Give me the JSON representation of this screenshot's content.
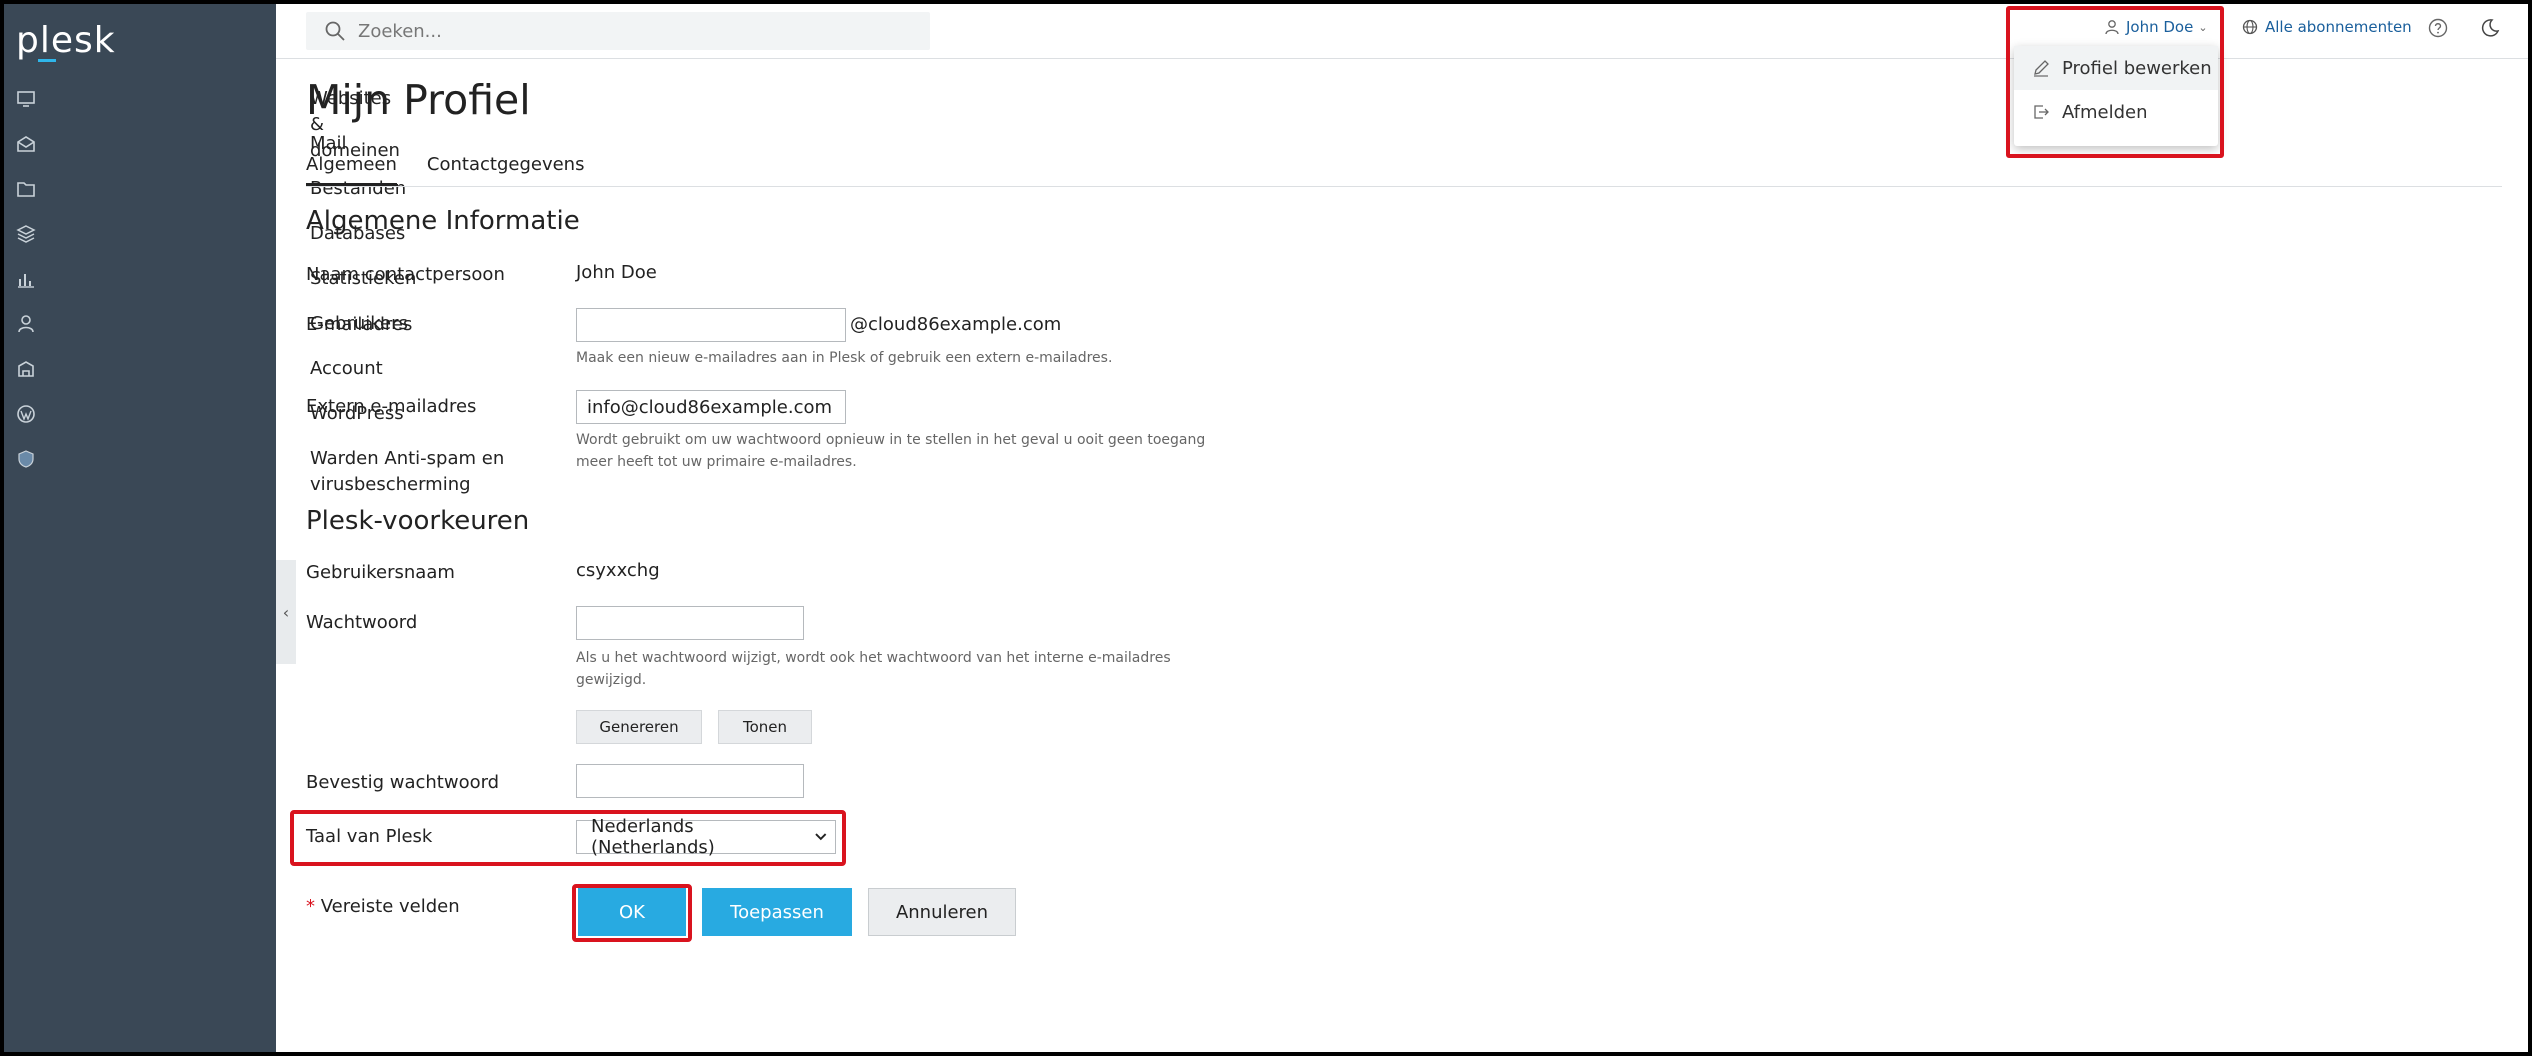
{
  "sidebar": {
    "logo": "plesk",
    "items": [
      {
        "label": "Websites & domeinen",
        "icon": "monitor-icon"
      },
      {
        "label": "Mail",
        "icon": "mail-icon"
      },
      {
        "label": "Bestanden",
        "icon": "folder-icon"
      },
      {
        "label": "Databases",
        "icon": "database-icon"
      },
      {
        "label": "Statistieken",
        "icon": "bar-chart-icon"
      },
      {
        "label": "Gebruikers",
        "icon": "user-icon"
      },
      {
        "label": "Account",
        "icon": "account-icon"
      },
      {
        "label": "WordPress",
        "icon": "wordpress-icon"
      },
      {
        "label": "Warden Anti-spam en virusbescherming",
        "icon": "shield-icon"
      }
    ]
  },
  "header": {
    "search_placeholder": "Zoeken...",
    "user_name": "John Doe",
    "subscriptions_label": "Alle abonnementen"
  },
  "user_menu": {
    "items": [
      {
        "label": "Profiel bewerken",
        "icon": "pencil-icon"
      },
      {
        "label": "Afmelden",
        "icon": "logout-icon"
      }
    ]
  },
  "page": {
    "title": "Mijn Profiel",
    "tabs": [
      "Algemeen",
      "Contactgegevens"
    ],
    "active_tab": "Algemeen"
  },
  "general": {
    "heading": "Algemene Informatie",
    "contact_label": "Naam contactpersoon",
    "contact_value": "John Doe",
    "email_label": "E-mailadres",
    "email_value": "",
    "email_suffix": "@cloud86example.com",
    "email_hint": "Maak een nieuw e-mailadres aan in Plesk of gebruik een extern e-mailadres.",
    "ext_email_label": "Extern e-mailadres",
    "ext_email_value": "info@cloud86example.com",
    "ext_email_hint_1": "Wordt gebruikt om uw wachtwoord opnieuw in te stellen in het geval u ooit geen toegang",
    "ext_email_hint_2": "meer heeft tot uw primaire e-mailadres."
  },
  "prefs": {
    "heading": "Plesk-voorkeuren",
    "username_label": "Gebruikersnaam",
    "username_value": "csyxxchg",
    "password_label": "Wachtwoord",
    "password_hint_1": "Als u het wachtwoord wijzigt, wordt ook het wachtwoord van het interne e-mailadres",
    "password_hint_2": "gewijzigd.",
    "generate_label": "Genereren",
    "show_label": "Tonen",
    "confirm_label": "Bevestig wachtwoord",
    "language_label": "Taal van Plesk",
    "language_value": "Nederlands (Netherlands)"
  },
  "footer": {
    "required_star": "*",
    "required_text": " Vereiste velden",
    "ok_label": "OK",
    "apply_label": "Toepassen",
    "cancel_label": "Annuleren"
  },
  "colors": {
    "sidebar_bg": "#3a4856",
    "primary": "#28aae1",
    "link": "#1a5f9c",
    "highlight": "#d9131e"
  }
}
